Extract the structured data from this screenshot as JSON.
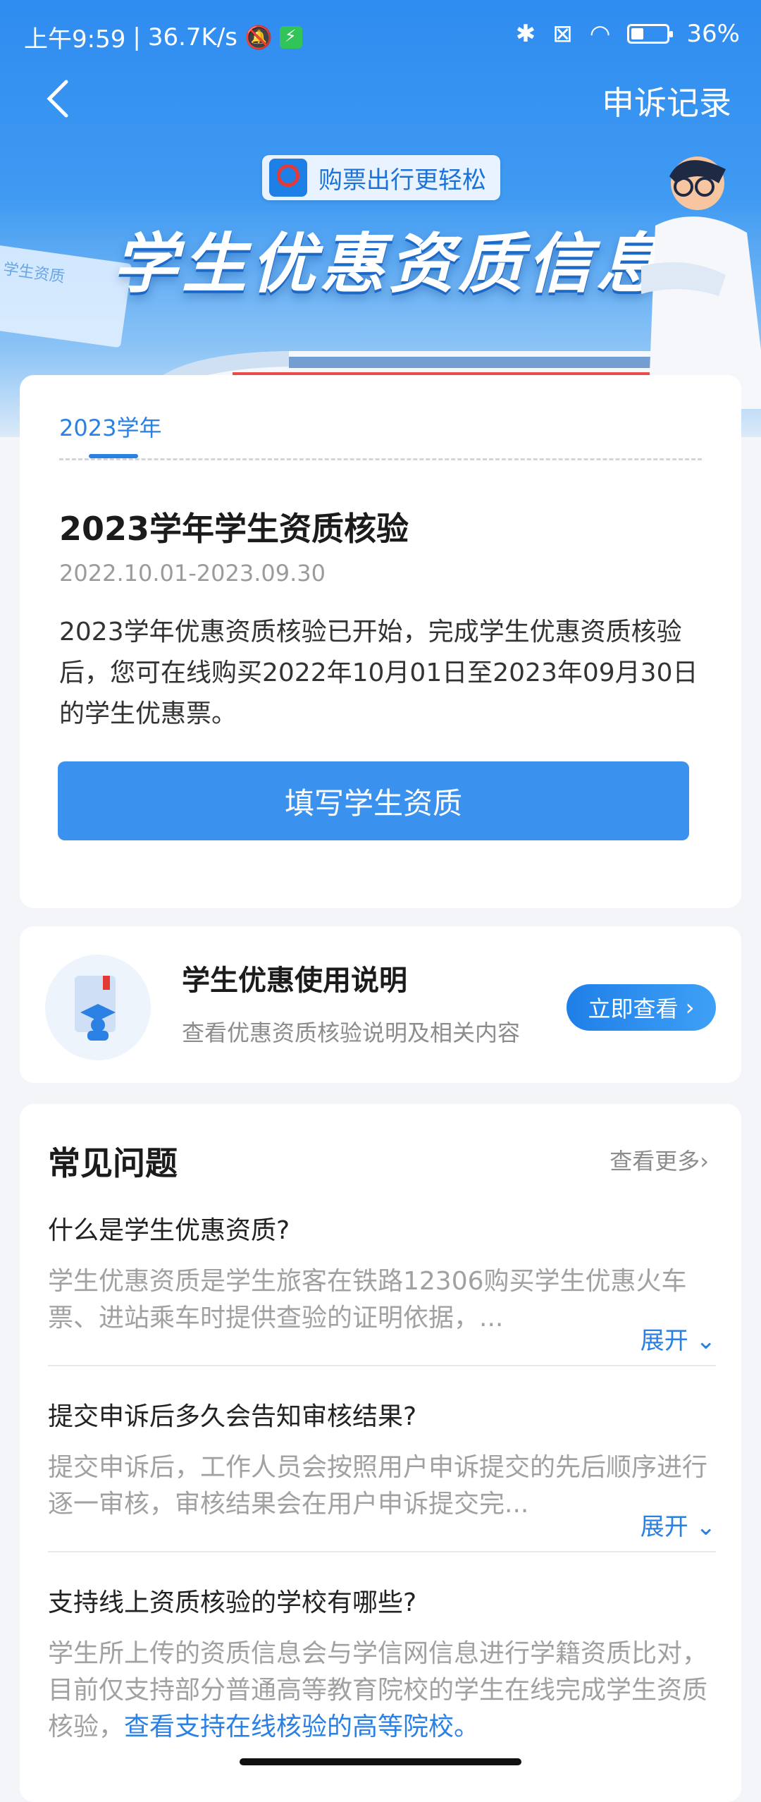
{
  "status_bar": {
    "time": "上午9:59",
    "separator": "|",
    "speed": "36.7K/s",
    "battery": "36%",
    "battery_level": 0.36
  },
  "header": {
    "appeal_label": "申诉记录"
  },
  "hero": {
    "badge_text": "购票出行更轻松",
    "title": "学生优惠资质信息",
    "paper_text": "学生资质"
  },
  "qualification": {
    "tab_label": "2023学年",
    "title": "2023学年学生资质核验",
    "date_range": "2022.10.01-2023.09.30",
    "description": "2023学年优惠资质核验已开始，完成学生优惠资质核验后，您可在线购买2022年10月01日至2023年09月30日的学生优惠票。",
    "button_label": "填写学生资质"
  },
  "guide": {
    "title": "学生优惠使用说明",
    "subtitle": "查看优惠资质核验说明及相关内容",
    "button_label": "立即查看"
  },
  "faq": {
    "heading": "常见问题",
    "more_label": "查看更多",
    "items": [
      {
        "question": "什么是学生优惠资质?",
        "answer": "学生优惠资质是学生旅客在铁路12306购买学生优惠火车票、进站乘车时提供查验的证明依据，...",
        "expand_label": "展开"
      },
      {
        "question": "提交申诉后多久会告知审核结果?",
        "answer": "提交申诉后，工作人员会按照用户申诉提交的先后顺序进行逐一审核，审核结果会在用户申诉提交完...",
        "expand_label": "展开"
      },
      {
        "question": "支持线上资质核验的学校有哪些?",
        "answer": "学生所上传的资质信息会与学信网信息进行学籍资质比对，目前仅支持部分普通高等教育院校的学生在线完成学生资质核验，",
        "link_text": "查看支持在线核验的高等院校。"
      }
    ]
  }
}
